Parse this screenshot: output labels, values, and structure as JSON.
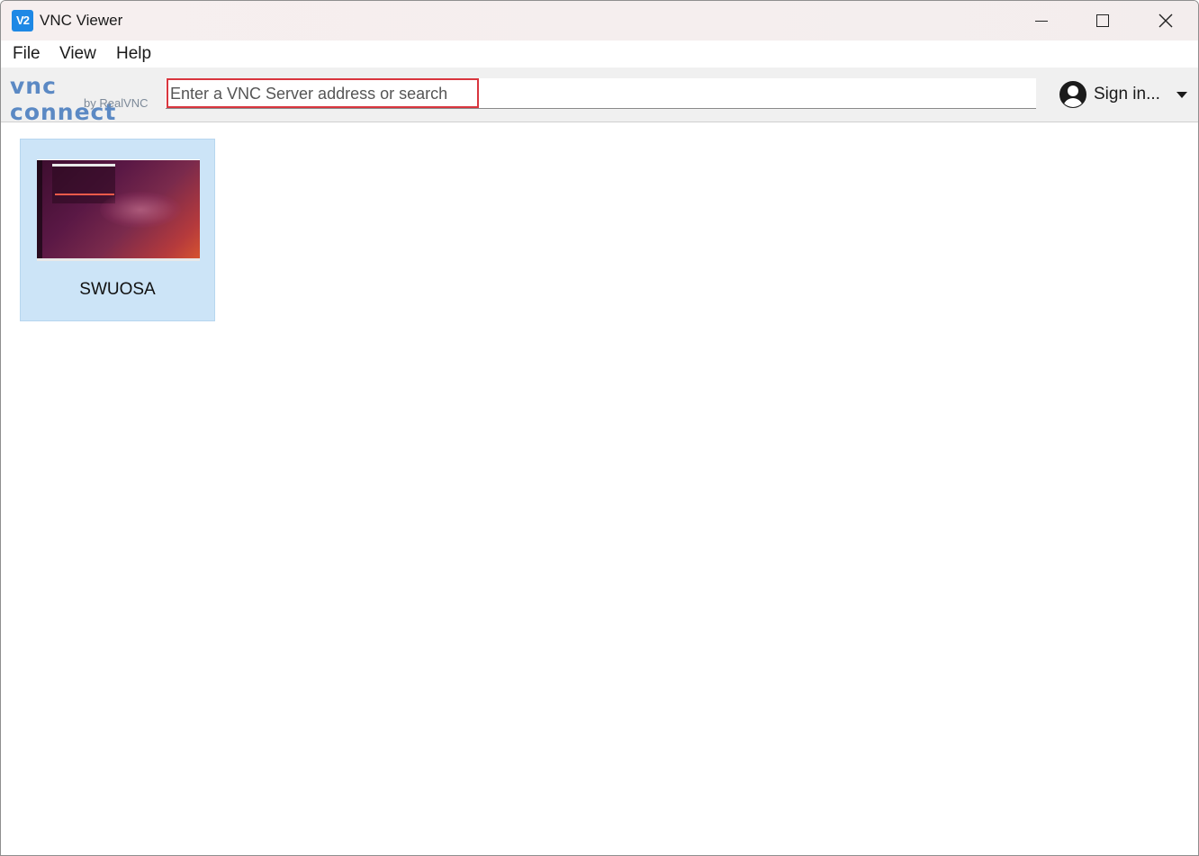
{
  "window": {
    "title": "VNC Viewer",
    "app_icon_text": "V2"
  },
  "menu": {
    "items": [
      {
        "label": "File"
      },
      {
        "label": "View"
      },
      {
        "label": "Help"
      }
    ]
  },
  "toolbar": {
    "logo_main": "vnc connect",
    "logo_sub": "by RealVNC",
    "search": {
      "value": "",
      "placeholder": "Enter a VNC Server address or search"
    },
    "signin_label": "Sign in..."
  },
  "connections": [
    {
      "name": "SWUOSA"
    }
  ],
  "icons": {
    "app": "vnc-viewer-app-icon",
    "minimize": "minimize-icon",
    "maximize": "maximize-icon",
    "close": "close-icon",
    "avatar": "user-avatar-icon",
    "dropdown": "chevron-down-icon"
  },
  "colors": {
    "accent": "#1e88e5",
    "selection": "#cce4f7",
    "highlight_border": "#d9363e",
    "logo": "#5b89c4"
  }
}
